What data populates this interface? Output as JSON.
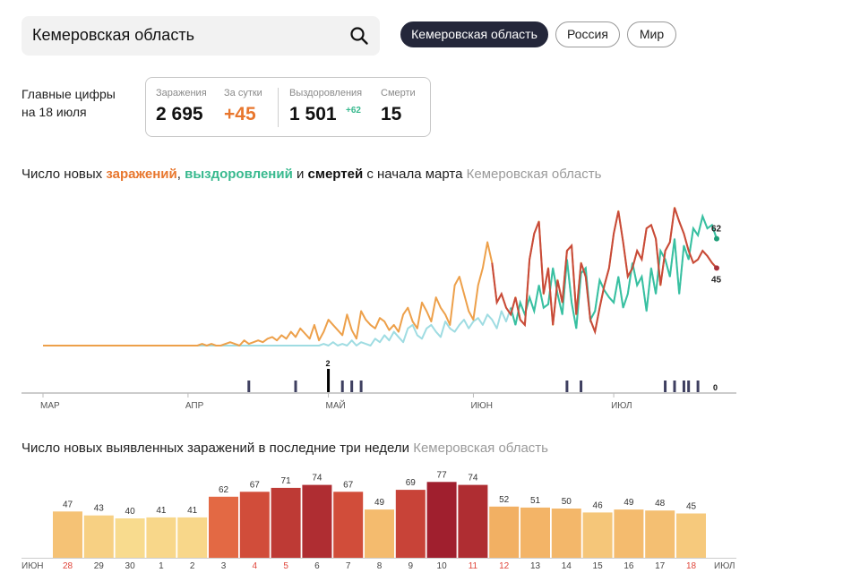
{
  "search": {
    "value": "Кемеровская область"
  },
  "regions": [
    {
      "label": "Кемеровская область",
      "active": true
    },
    {
      "label": "Россия",
      "active": false
    },
    {
      "label": "Мир",
      "active": false
    }
  ],
  "summary": {
    "heading_line1": "Главные цифры",
    "heading_line2": "на 18 июля",
    "infections_label": "Заражения",
    "infections_value": "2 695",
    "daily_label": "За сутки",
    "daily_value": "+45",
    "recoveries_label": "Выздоровления",
    "recoveries_value": "1 501",
    "recoveries_delta": "+62",
    "deaths_label": "Смерти",
    "deaths_value": "15"
  },
  "colors": {
    "infections": "#e8772e",
    "recoveries": "#38b98e",
    "deaths": "#2c2c4a"
  },
  "chart_data": [
    {
      "type": "line",
      "title_parts": {
        "prefix": "Число новых ",
        "infections": "заражений",
        "comma": ", ",
        "recoveries": "выздоровлений",
        "and": " и ",
        "deaths": "смертей",
        "suffix": " с начала марта"
      },
      "region": "Кемеровская область",
      "x_ticks": [
        "МАР",
        "АПР",
        "МАЙ",
        "ИЮН",
        "ИЮЛ"
      ],
      "x_tick_days": [
        0,
        31,
        61,
        92,
        122
      ],
      "days_total": 145,
      "ylim": [
        0,
        80
      ],
      "series": [
        {
          "key": "infections",
          "values": [
            0,
            0,
            0,
            0,
            0,
            0,
            0,
            0,
            0,
            0,
            0,
            0,
            0,
            0,
            0,
            0,
            0,
            0,
            0,
            0,
            0,
            0,
            0,
            0,
            0,
            0,
            0,
            0,
            0,
            0,
            0,
            0,
            0,
            0,
            1,
            0,
            1,
            0,
            0,
            1,
            2,
            1,
            0,
            3,
            1,
            2,
            3,
            2,
            4,
            5,
            3,
            6,
            4,
            8,
            5,
            10,
            7,
            4,
            12,
            3,
            8,
            15,
            12,
            9,
            6,
            18,
            9,
            4,
            20,
            15,
            12,
            10,
            16,
            14,
            9,
            12,
            8,
            18,
            22,
            14,
            10,
            25,
            20,
            14,
            28,
            22,
            18,
            12,
            35,
            40,
            30,
            20,
            15,
            35,
            45,
            60,
            48,
            25,
            30,
            22,
            18,
            28,
            15,
            12,
            50,
            65,
            72,
            30,
            45,
            12,
            38,
            25,
            55,
            58,
            18,
            48,
            40,
            15,
            8,
            22,
            35,
            45,
            65,
            78,
            60,
            40,
            45,
            55,
            50,
            68,
            70,
            62,
            35,
            55,
            60,
            80,
            72,
            65,
            55,
            48,
            50,
            55,
            52,
            48,
            45
          ]
        },
        {
          "key": "recoveries",
          "values": [
            0,
            0,
            0,
            0,
            0,
            0,
            0,
            0,
            0,
            0,
            0,
            0,
            0,
            0,
            0,
            0,
            0,
            0,
            0,
            0,
            0,
            0,
            0,
            0,
            0,
            0,
            0,
            0,
            0,
            0,
            0,
            0,
            0,
            0,
            0,
            0,
            0,
            0,
            0,
            0,
            0,
            0,
            0,
            0,
            0,
            0,
            0,
            0,
            0,
            0,
            0,
            0,
            0,
            0,
            0,
            0,
            0,
            0,
            0,
            0,
            1,
            0,
            2,
            0,
            1,
            0,
            3,
            0,
            2,
            1,
            0,
            4,
            2,
            6,
            3,
            8,
            5,
            2,
            10,
            12,
            6,
            4,
            10,
            12,
            8,
            5,
            14,
            10,
            8,
            12,
            15,
            10,
            14,
            16,
            12,
            18,
            15,
            10,
            20,
            14,
            22,
            12,
            25,
            18,
            28,
            20,
            35,
            22,
            24,
            45,
            30,
            18,
            50,
            25,
            10,
            42,
            45,
            15,
            20,
            38,
            32,
            28,
            25,
            40,
            22,
            30,
            48,
            35,
            40,
            20,
            45,
            30,
            55,
            50,
            40,
            62,
            30,
            58,
            50,
            68,
            64,
            75,
            68,
            70,
            62
          ]
        },
        {
          "key": "deaths",
          "values": [
            0,
            0,
            0,
            0,
            0,
            0,
            0,
            0,
            0,
            0,
            0,
            0,
            0,
            0,
            0,
            0,
            0,
            0,
            0,
            0,
            0,
            0,
            0,
            0,
            0,
            0,
            0,
            0,
            0,
            0,
            0,
            0,
            0,
            0,
            0,
            0,
            0,
            0,
            0,
            0,
            0,
            0,
            0,
            0,
            1,
            0,
            0,
            0,
            0,
            0,
            0,
            0,
            0,
            0,
            1,
            0,
            0,
            0,
            0,
            0,
            0,
            2,
            0,
            0,
            1,
            0,
            1,
            0,
            1,
            0,
            0,
            0,
            0,
            0,
            0,
            0,
            0,
            0,
            0,
            0,
            0,
            0,
            0,
            0,
            0,
            0,
            0,
            0,
            0,
            0,
            0,
            0,
            0,
            0,
            0,
            0,
            0,
            0,
            0,
            0,
            0,
            0,
            0,
            0,
            0,
            0,
            0,
            0,
            0,
            0,
            0,
            0,
            1,
            0,
            0,
            1,
            0,
            0,
            0,
            0,
            0,
            0,
            0,
            0,
            0,
            0,
            0,
            0,
            0,
            0,
            0,
            0,
            0,
            1,
            0,
            1,
            0,
            1,
            1,
            0,
            1,
            0,
            0,
            0,
            0
          ]
        }
      ],
      "end_labels": {
        "recoveries": "62",
        "infections": "45",
        "deaths": "0",
        "deaths_peak": "2"
      }
    },
    {
      "type": "bar",
      "title": "Число новых выявленных заражений в последние три недели",
      "region": "Кемеровская область",
      "start_month": "ИЮН",
      "end_month": "ИЮЛ",
      "categories": [
        "28",
        "29",
        "30",
        "1",
        "2",
        "3",
        "4",
        "5",
        "6",
        "7",
        "8",
        "9",
        "10",
        "11",
        "12",
        "13",
        "14",
        "15",
        "16",
        "17",
        "18"
      ],
      "weekend": [
        true,
        false,
        false,
        false,
        false,
        false,
        true,
        true,
        false,
        false,
        false,
        false,
        false,
        true,
        true,
        false,
        false,
        false,
        false,
        false,
        true
      ],
      "values": [
        47,
        43,
        40,
        41,
        41,
        62,
        67,
        71,
        74,
        67,
        49,
        69,
        77,
        74,
        52,
        51,
        50,
        46,
        49,
        48,
        45
      ],
      "ylim": [
        0,
        80
      ]
    }
  ]
}
